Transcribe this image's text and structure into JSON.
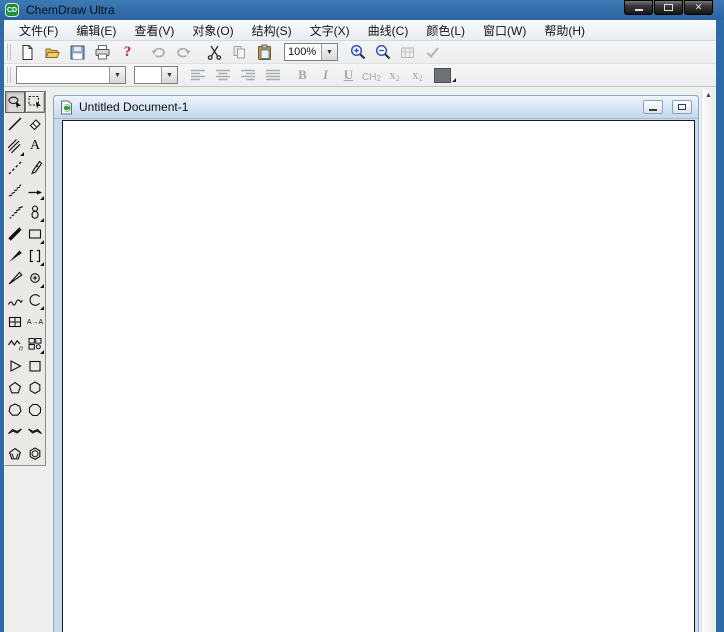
{
  "window": {
    "title": "ChemDraw Ultra",
    "app_icon_label": "CD"
  },
  "menu": {
    "items": [
      "文件(F)",
      "编辑(E)",
      "查看(V)",
      "对象(O)",
      "结构(S)",
      "文字(X)",
      "曲线(C)",
      "颜色(L)",
      "窗口(W)",
      "帮助(H)"
    ]
  },
  "toolbar_standard": {
    "zoom_value": "100%",
    "buttons": [
      "new",
      "open",
      "save",
      "print",
      "help",
      "undo",
      "redo",
      "cut",
      "copy",
      "paste",
      "zoom-in",
      "zoom-out",
      "periodic-table",
      "check-structure"
    ]
  },
  "toolbar_text": {
    "font_value": "",
    "size_value": "",
    "bold": "B",
    "italic": "I",
    "underline": "U",
    "formula_base": "CH",
    "formula_sub": "2",
    "subscript_base": "x",
    "subscript_sub": "2",
    "superscript_base": "x",
    "superscript_sup": "2"
  },
  "tool_palette": {
    "selected_tool": "lasso",
    "text_tool_label": "A",
    "atom_to_atom_label": "A→A",
    "polymer_n_label": "n",
    "tools": [
      [
        "lasso",
        "marquee"
      ],
      [
        "solid-bond",
        "eraser"
      ],
      [
        "multiple-bond",
        "text"
      ],
      [
        "dashed-bond",
        "pen"
      ],
      [
        "hashed-bond",
        "arrow"
      ],
      [
        "hashed-wedge-bond",
        "orbital"
      ],
      [
        "bold-bond",
        "rectangle"
      ],
      [
        "wedge-bond",
        "bracket"
      ],
      [
        "hollow-wedge-bond",
        "chemical-symbol"
      ],
      [
        "wavy-bond",
        "arc"
      ],
      [
        "table",
        "atom-to-atom"
      ],
      [
        "polymer-repeat",
        "templates"
      ],
      [
        "cyclopropane-ring",
        "cyclobutane-ring"
      ],
      [
        "cyclopentane-ring",
        "cyclohexane-ring"
      ],
      [
        "cycloheptane-ring",
        "cyclooctane-ring"
      ],
      [
        "chair-cyclohexane-1",
        "chair-cyclohexane-2"
      ],
      [
        "cyclopentadiene-ring",
        "benzene-ring"
      ]
    ]
  },
  "document_window": {
    "title": "Untitled Document-1"
  },
  "icons": {
    "dropdown_arrow": "▼",
    "scroll_up_arrow": "▲",
    "close_glyph": "✕",
    "help_glyph": "?"
  },
  "colors": {
    "titlebar_blue": "#2e6ba6",
    "doc_titlebar_blue": "#c3d9ee",
    "canvas_white": "#ffffff",
    "palette_bg": "#ebe9e5",
    "mdi_bg": "#eef0ee",
    "disabled_gray": "#a2a7ac",
    "zoom_lens_blue": "#2b51c8",
    "help_red": "#c42020",
    "app_icon_green": "#1e8e3e"
  }
}
